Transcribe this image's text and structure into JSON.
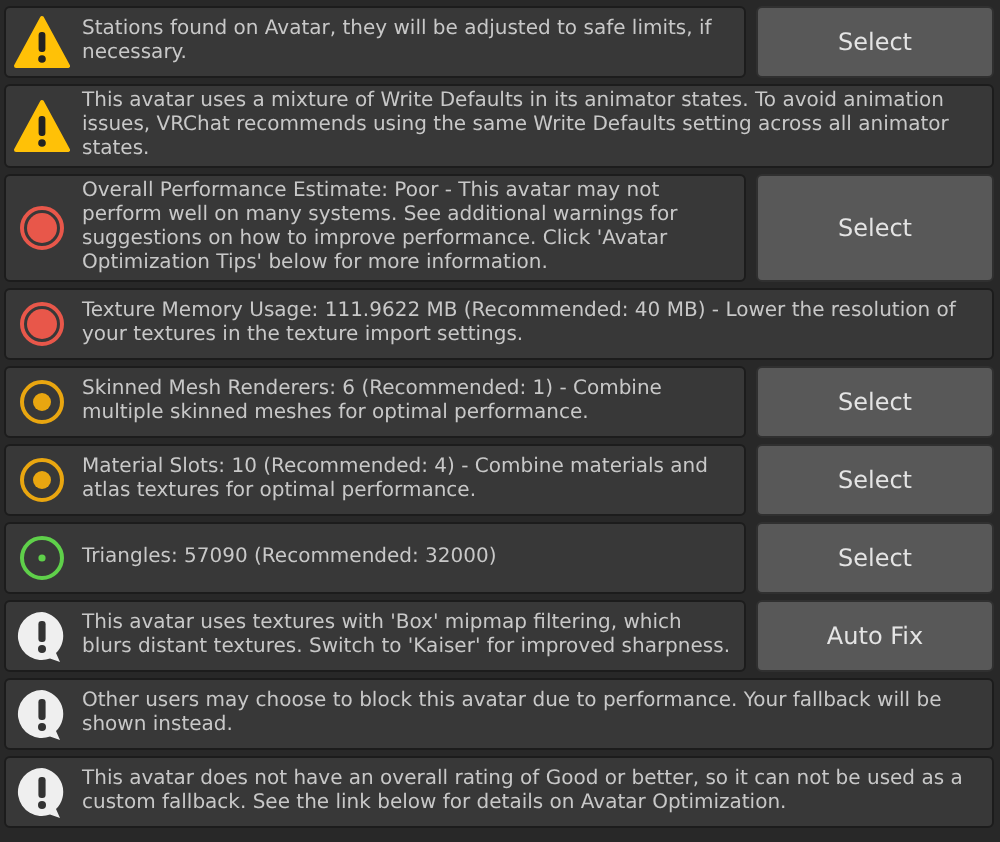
{
  "messages": [
    {
      "kind": "warning",
      "text": "Stations found on Avatar, they will be adjusted to safe limits, if necessary.",
      "button": "Select"
    },
    {
      "kind": "warning",
      "text": "This avatar uses a mixture of Write Defaults in its animator states. To avoid animation issues, VRChat recommends using the same Write Defaults setting across all animator states."
    },
    {
      "kind": "poor",
      "text": "Overall Performance Estimate: Poor - This avatar may not perform well on many systems. See additional warnings for suggestions on how to improve performance. Click 'Avatar Optimization Tips' below for more information.",
      "button": "Select"
    },
    {
      "kind": "poor",
      "text": "Texture Memory Usage: 111.9622 MB (Recommended: 40 MB) - Lower the resolution of your textures in the texture import settings."
    },
    {
      "kind": "medium",
      "text": "Skinned Mesh Renderers: 6 (Recommended: 1) - Combine multiple skinned meshes for optimal performance.",
      "button": "Select"
    },
    {
      "kind": "medium",
      "text": "Material Slots: 10 (Recommended: 4) - Combine materials and atlas textures for optimal performance.",
      "button": "Select"
    },
    {
      "kind": "good",
      "text": "Triangles: 57090 (Recommended: 32000)",
      "button": "Select"
    },
    {
      "kind": "info",
      "text": "This avatar uses textures with 'Box' mipmap filtering, which blurs distant textures. Switch to 'Kaiser' for improved sharpness.",
      "button": "Auto Fix"
    },
    {
      "kind": "info",
      "text": "Other users may choose to block this avatar due to performance. Your fallback will be shown instead."
    },
    {
      "kind": "info",
      "text": "This avatar does not have an overall rating of Good or better, so it can not be used as a custom fallback. See the link below for details on Avatar Optimization."
    }
  ]
}
